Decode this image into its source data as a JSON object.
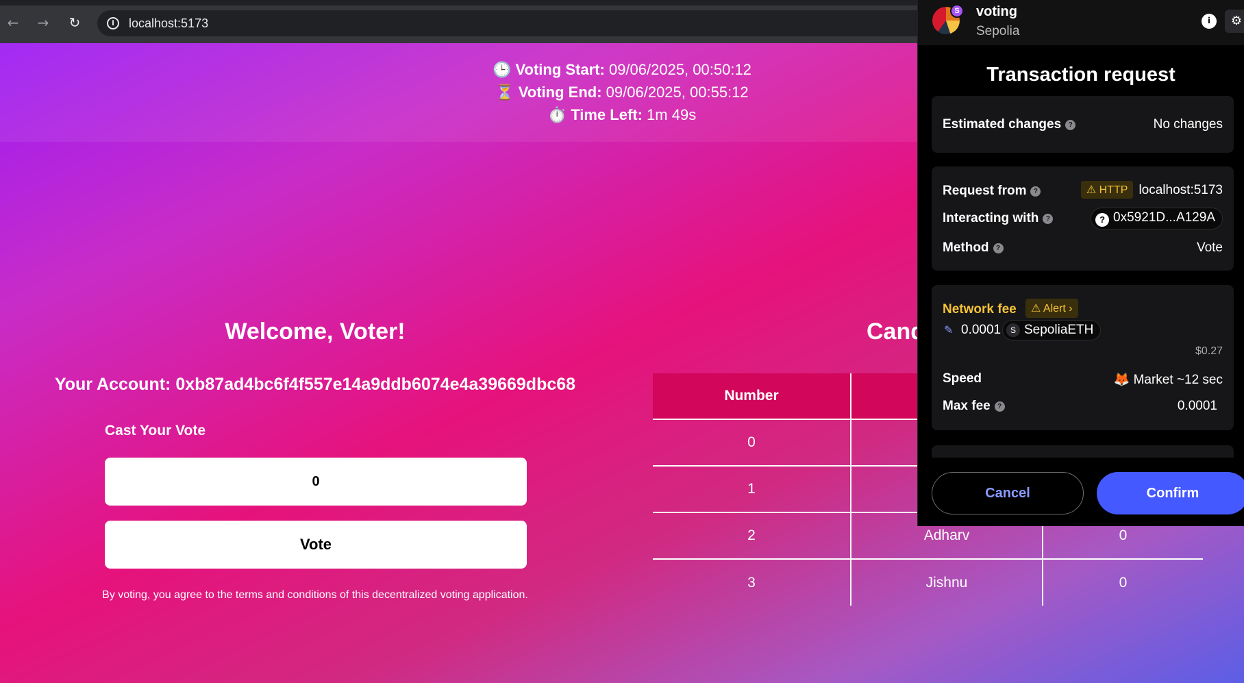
{
  "browser": {
    "url": "localhost:5173"
  },
  "timer": {
    "start_icon": "🕒",
    "start_label": "Voting Start:",
    "start_value": "09/06/2025, 00:50:12",
    "end_icon": "⏳",
    "end_label": "Voting End:",
    "end_value": "09/06/2025, 00:55:12",
    "left_icon": "⏱️",
    "left_label": "Time Left:",
    "left_value": "1m 49s"
  },
  "voter": {
    "welcome": "Welcome, Voter!",
    "account": "Your Account: 0xb87ad4bc6f4f557e14a9ddb6074e4a39669dbc68",
    "cast_label": "Cast Your Vote",
    "input_value": "0",
    "vote_button": "Vote",
    "terms": "By voting, you agree to the terms and conditions of this decentralized voting application."
  },
  "candidates": {
    "title": "Cand",
    "headers": [
      "Number",
      "",
      ""
    ],
    "rows": [
      [
        "0",
        "",
        ""
      ],
      [
        "1",
        "",
        ""
      ],
      [
        "2",
        "Adharv",
        "0"
      ],
      [
        "3",
        "Jishnu",
        "0"
      ]
    ]
  },
  "wallet": {
    "site_name": "voting",
    "network": "Sepolia",
    "badge": "S",
    "title": "Transaction request",
    "estimated_changes_label": "Estimated changes",
    "estimated_changes_value": "No changes",
    "request_from_label": "Request from",
    "http_badge": "⚠ HTTP",
    "request_from_value": "localhost:5173",
    "interacting_label": "Interacting with",
    "interacting_value": "0x5921D...A129A",
    "method_label": "Method",
    "method_value": "Vote",
    "network_fee_label": "Network fee",
    "alert_badge": "⚠ Alert ›",
    "fee_amount": "0.0001",
    "fee_token_icon": "S",
    "fee_token": "SepoliaETH",
    "fee_usd": "$0.27",
    "speed_label": "Speed",
    "speed_value": "Market ~12 sec",
    "max_fee_label": "Max fee",
    "max_fee_value": "0.0001",
    "cancel_button": "Cancel",
    "confirm_button": "Confirm"
  }
}
